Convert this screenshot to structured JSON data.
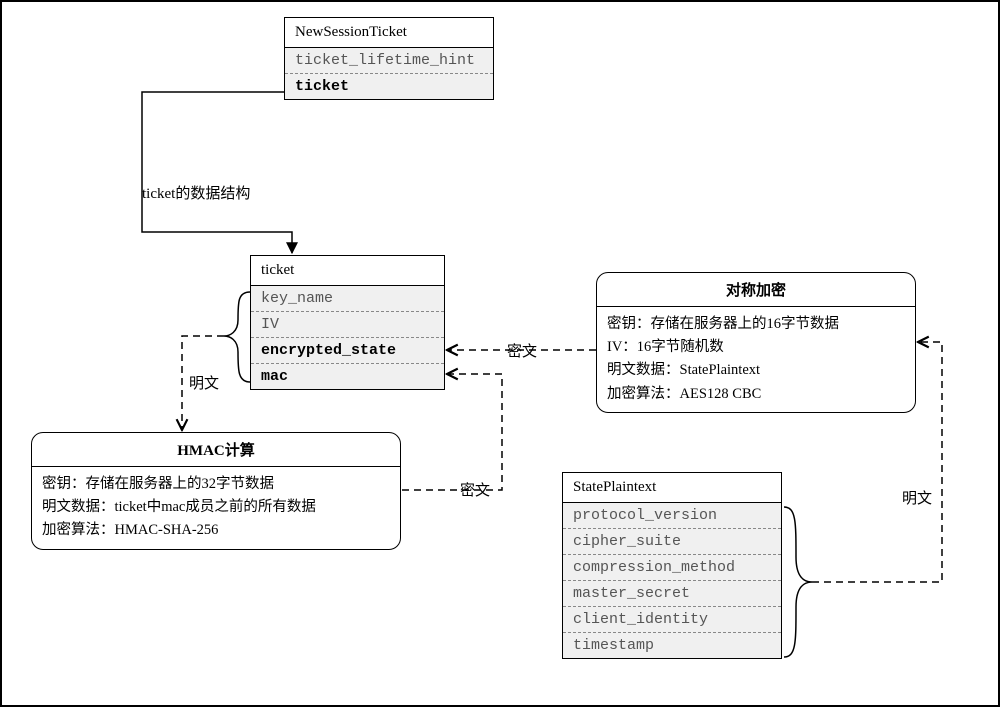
{
  "boxes": {
    "newSessionTicket": {
      "title": "NewSessionTicket",
      "rows": [
        {
          "text": "ticket_lifetime_hint",
          "bold": false
        },
        {
          "text": "ticket",
          "bold": true
        }
      ]
    },
    "ticket": {
      "title": "ticket",
      "rows": [
        {
          "text": "key_name",
          "bold": false
        },
        {
          "text": "IV",
          "bold": false
        },
        {
          "text": "encrypted_state",
          "bold": true
        },
        {
          "text": "mac",
          "bold": true
        }
      ]
    },
    "symEnc": {
      "title": "对称加密",
      "lines": [
        "密钥：存储在服务器上的16字节数据",
        "IV：16字节随机数",
        "明文数据：StatePlaintext",
        "加密算法：AES128 CBC"
      ]
    },
    "hmac": {
      "title": "HMAC计算",
      "lines": [
        "密钥：存储在服务器上的32字节数据",
        "明文数据：ticket中mac成员之前的所有数据",
        "加密算法：HMAC-SHA-256"
      ]
    },
    "statePlaintext": {
      "title": "StatePlaintext",
      "rows": [
        {
          "text": "protocol_version",
          "bold": false
        },
        {
          "text": "cipher_suite",
          "bold": false
        },
        {
          "text": "compression_method",
          "bold": false
        },
        {
          "text": "master_secret",
          "bold": false
        },
        {
          "text": "client_identity",
          "bold": false
        },
        {
          "text": "timestamp",
          "bold": false
        }
      ]
    }
  },
  "labels": {
    "ticketDataStructure": "ticket的数据结构",
    "plaintext1": "明文",
    "plaintext2": "明文",
    "ciphertext1": "密文",
    "ciphertext2": "密文"
  }
}
